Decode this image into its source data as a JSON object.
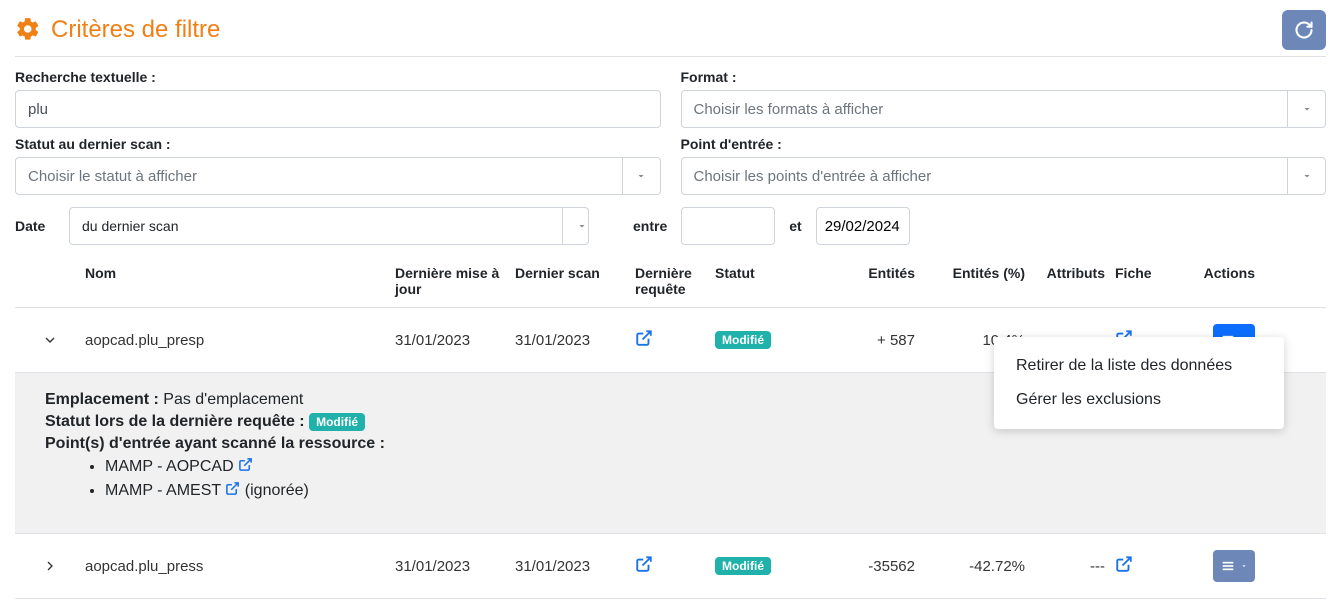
{
  "header": {
    "title": "Critères de filtre"
  },
  "filters": {
    "search_label": "Recherche textuelle :",
    "search_value": "plu",
    "format_label": "Format :",
    "format_placeholder": "Choisir les formats à afficher",
    "status_label": "Statut au dernier scan :",
    "status_placeholder": "Choisir le statut à afficher",
    "entry_label": "Point d'entrée :",
    "entry_placeholder": "Choisir les points d'entrée à afficher",
    "date_label": "Date",
    "date_mode": "du dernier scan",
    "between_label": "entre",
    "et_label": "et",
    "date_to": "29/02/2024"
  },
  "columns": {
    "name": "Nom",
    "updated": "Dernière mise à jour",
    "scan": "Dernier scan",
    "request": "Dernière requête",
    "status": "Statut",
    "entities": "Entités",
    "entities_pct": "Entités (%)",
    "attrs": "Attributs",
    "sheet": "Fiche",
    "actions": "Actions"
  },
  "rows": [
    {
      "name": "aopcad.plu_presp",
      "updated": "31/01/2023",
      "scan": "31/01/2023",
      "status": "Modifié",
      "entities": "+ 587",
      "entities_pct": "10.4%",
      "attrs": "---",
      "expanded": true
    },
    {
      "name": "aopcad.plu_press",
      "updated": "31/01/2023",
      "scan": "31/01/2023",
      "status": "Modifié",
      "entities": "-35562",
      "entities_pct": "-42.72%",
      "attrs": "---",
      "expanded": false
    }
  ],
  "detail": {
    "loc_label": "Emplacement :",
    "loc_value": "Pas d'emplacement",
    "status_req_label": "Statut lors de la dernière requête :",
    "status_req_badge": "Modifié",
    "entries_label": "Point(s) d'entrée ayant scanné la ressource :",
    "entries": [
      {
        "text": "MAMP - AOPCAD",
        "suffix": ""
      },
      {
        "text": "MAMP - AMEST",
        "suffix": "(ignorée)"
      }
    ]
  },
  "menu": {
    "remove": "Retirer de la liste des données",
    "manage": "Gérer les exclusions"
  }
}
